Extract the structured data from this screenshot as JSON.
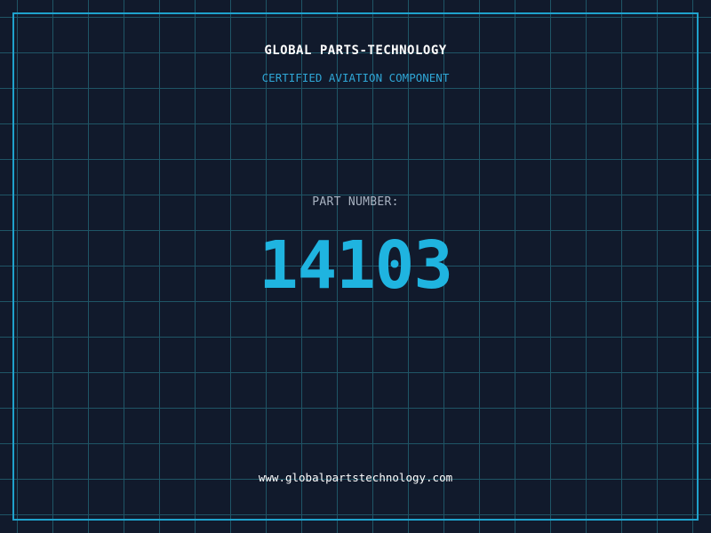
{
  "card": {
    "company_name": "GLOBAL PARTS-TECHNOLOGY",
    "tagline": "CERTIFIED AVIATION COMPONENT",
    "part_label": "PART NUMBER:",
    "part_number": "14103",
    "website": "www.globalpartstechnology.com"
  },
  "colors": {
    "background": "#111a2c",
    "grid": "#1f5566",
    "frame": "#1fa2cc",
    "accent": "#1fb4e0",
    "tagline": "#2fa6d6",
    "label": "#a9b3c2",
    "text": "#ffffff"
  }
}
